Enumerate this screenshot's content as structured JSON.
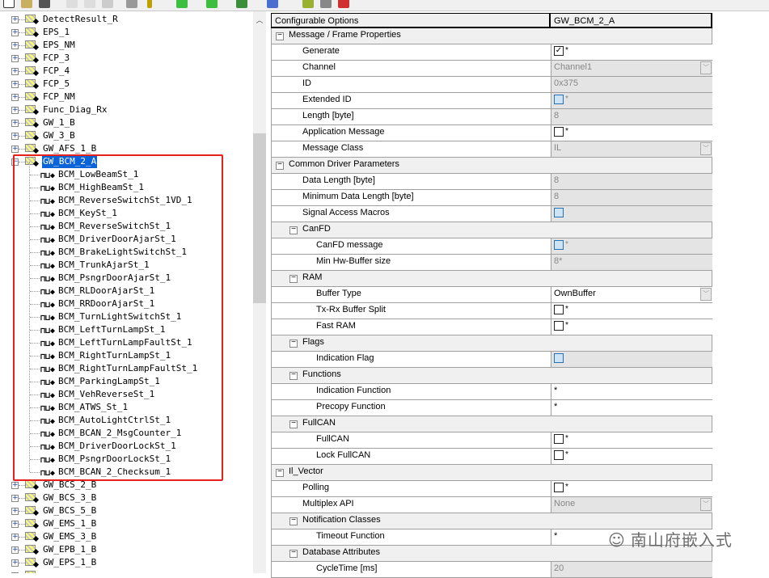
{
  "tree": {
    "before": [
      "DetectResult_R",
      "EPS_1",
      "EPS_NM",
      "FCP_3",
      "FCP_4",
      "FCP_5",
      "FCP_NM",
      "Func_Diag_Rx",
      "GW_1_B",
      "GW_3_B",
      "GW_AFS_1_B"
    ],
    "selected": "GW_BCM_2_A",
    "signals": [
      "BCM_LowBeamSt_1",
      "BCM_HighBeamSt_1",
      "BCM_ReverseSwitchSt_1VD_1",
      "BCM_KeySt_1",
      "BCM_ReverseSwitchSt_1",
      "BCM_DriverDoorAjarSt_1",
      "BCM_BrakeLightSwitchSt_1",
      "BCM_TrunkAjarSt_1",
      "BCM_PsngrDoorAjarSt_1",
      "BCM_RLDoorAjarSt_1",
      "BCM_RRDoorAjarSt_1",
      "BCM_TurnLightSwitchSt_1",
      "BCM_LeftTurnLampSt_1",
      "BCM_LeftTurnLampFaultSt_1",
      "BCM_RightTurnLampSt_1",
      "BCM_RightTurnLampFaultSt_1",
      "BCM_ParkingLampSt_1",
      "BCM_VehReverseSt_1",
      "BCM_ATWS_St_1",
      "BCM_AutoLightCtrlSt_1",
      "BCM_BCAN_2_MsgCounter_1",
      "BCM_DriverDoorLockSt_1",
      "BCM_PsngrDoorLockSt_1",
      "BCM_BCAN_2_Checksum_1"
    ],
    "after": [
      "GW_BCS_2_B",
      "GW_BCS_3_B",
      "GW_BCS_5_B",
      "GW_EMS_1_B",
      "GW_EMS_3_B",
      "GW_EPB_1_B",
      "GW_EPS_1_B"
    ]
  },
  "grid": {
    "header": {
      "col1": "Configurable Options",
      "col2": "GW_BCM_2_A"
    },
    "rows": [
      {
        "t": "section",
        "level": 0,
        "label": "Message / Frame Properties"
      },
      {
        "t": "cb",
        "level": 1,
        "label": "Generate",
        "checked": true,
        "star": "*"
      },
      {
        "t": "dd",
        "level": 1,
        "label": "Channel",
        "value": "Channel1",
        "disabled": true
      },
      {
        "t": "text",
        "level": 1,
        "label": "ID",
        "value": "0x375",
        "disabled": true
      },
      {
        "t": "cb",
        "level": 1,
        "label": "Extended ID",
        "blue": true,
        "star": "*",
        "disabled": true
      },
      {
        "t": "text",
        "level": 1,
        "label": "Length [byte]",
        "value": "8",
        "disabled": true
      },
      {
        "t": "cb",
        "level": 1,
        "label": "Application Message",
        "star": "*"
      },
      {
        "t": "dd",
        "level": 1,
        "label": "Message Class",
        "value": "IL",
        "disabled": true
      },
      {
        "t": "section",
        "level": 0,
        "label": "Common Driver Parameters"
      },
      {
        "t": "text",
        "level": 1,
        "label": "Data Length [byte]",
        "value": "8",
        "disabled": true
      },
      {
        "t": "text",
        "level": 1,
        "label": "Minimum Data Length [byte]",
        "value": "8",
        "disabled": true
      },
      {
        "t": "cb",
        "level": 1,
        "label": "Signal Access Macros",
        "blue": true,
        "disabled": true
      },
      {
        "t": "section",
        "level": 1,
        "label": "CanFD"
      },
      {
        "t": "cb",
        "level": 2,
        "label": "CanFD message",
        "blue": true,
        "star": "*",
        "disabled": true
      },
      {
        "t": "text",
        "level": 2,
        "label": "Min Hw-Buffer size",
        "value": "8*",
        "disabled": true
      },
      {
        "t": "section",
        "level": 1,
        "label": "RAM"
      },
      {
        "t": "dd",
        "level": 2,
        "label": "Buffer Type",
        "value": "OwnBuffer"
      },
      {
        "t": "cb",
        "level": 2,
        "label": "Tx-Rx Buffer Split",
        "star": "*"
      },
      {
        "t": "cb",
        "level": 2,
        "label": "Fast RAM",
        "star": "*"
      },
      {
        "t": "section",
        "level": 1,
        "label": "Flags"
      },
      {
        "t": "cb",
        "level": 2,
        "label": "Indication Flag",
        "blue": true,
        "disabled": true
      },
      {
        "t": "section",
        "level": 1,
        "label": "Functions"
      },
      {
        "t": "text",
        "level": 2,
        "label": "Indication Function",
        "value": "*"
      },
      {
        "t": "text",
        "level": 2,
        "label": "Precopy Function",
        "value": "*"
      },
      {
        "t": "section",
        "level": 1,
        "label": "FullCAN"
      },
      {
        "t": "cb",
        "level": 2,
        "label": "FullCAN",
        "star": "*"
      },
      {
        "t": "cb",
        "level": 2,
        "label": "Lock FullCAN",
        "star": "*"
      },
      {
        "t": "section",
        "level": 0,
        "label": "Il_Vector"
      },
      {
        "t": "cb",
        "level": 1,
        "label": "Polling",
        "star": "*"
      },
      {
        "t": "dd",
        "level": 1,
        "label": "Multiplex API",
        "value": "None",
        "disabled": true
      },
      {
        "t": "section",
        "level": 1,
        "label": "Notification Classes"
      },
      {
        "t": "text",
        "level": 2,
        "label": "Timeout Function",
        "value": "*"
      },
      {
        "t": "section",
        "level": 1,
        "label": "Database Attributes"
      },
      {
        "t": "text",
        "level": 2,
        "label": "CycleTime [ms]",
        "value": "20",
        "disabled": true
      }
    ]
  },
  "watermark": "南山府嵌入式",
  "colors": {
    "selection": "#0a64d8",
    "highlight_box": "#e8201c"
  }
}
